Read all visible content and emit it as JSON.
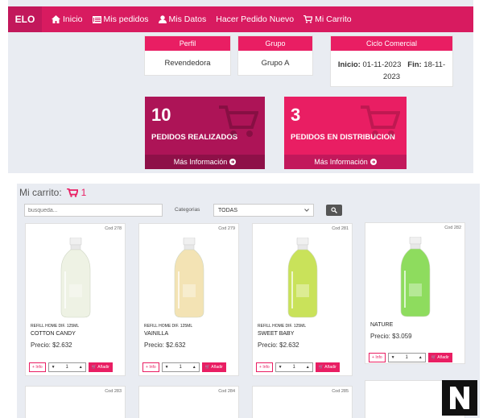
{
  "colors": {
    "primary": "#e91e63",
    "navbar": "#d81b60",
    "brand_bg": "#c2185b",
    "stat_dark": "#ad1457"
  },
  "nav": {
    "brand": "ELO",
    "items": [
      {
        "icon": "home-icon",
        "label": "Inicio"
      },
      {
        "icon": "list-icon",
        "label": "Mis pedidos"
      },
      {
        "icon": "user-icon",
        "label": "Mis Datos"
      },
      {
        "icon": "",
        "label": "Hacer Pedido Nuevo"
      },
      {
        "icon": "cart-icon",
        "label": "Mi Carrito"
      }
    ]
  },
  "profile": {
    "perfil": {
      "header": "Perfil",
      "value": "Revendedora"
    },
    "grupo": {
      "header": "Grupo",
      "value": "Grupo A"
    },
    "ciclo": {
      "header": "Ciclo Comercial",
      "start_label": "Inicio:",
      "start": "01-11-2023",
      "end_label": "Fin:",
      "end_day": "18-11-",
      "end_year": "2023"
    }
  },
  "stats": [
    {
      "number": "10",
      "label": "PEDIDOS REALIZADOS",
      "link": "Más Información"
    },
    {
      "number": "3",
      "label": "PEDIDOS EN DISTRIBUCION",
      "link": "Más Información"
    }
  ],
  "cart": {
    "title": "Mi carrito:",
    "count": "1",
    "search_placeholder": "busqueda...",
    "categories_label": "Categorias",
    "category_selected": "TODAS"
  },
  "products": [
    {
      "code": "Cod 278",
      "kind": "REFILL HOME DIF. 125ML",
      "name": "COTTON CANDY",
      "price": "Precio: $2.632",
      "liquid": "#eef2e4"
    },
    {
      "code": "Cod 279",
      "kind": "REFILL HOME DIF. 125ML",
      "name": "VAINILLA",
      "price": "Precio: $2.632",
      "liquid": "#f3e3b4"
    },
    {
      "code": "Cod 281",
      "kind": "REFILL HOME DIF. 125ML",
      "name": "SWEET BABY",
      "price": "Precio: $2.632",
      "liquid": "#c9e25a"
    },
    {
      "code": "Cod 282",
      "kind": "",
      "name": "NATURE",
      "price": "Precio: $3.059",
      "liquid": "#8edc5e"
    }
  ],
  "products_next_row": [
    {
      "code": "Cod 283"
    },
    {
      "code": "Cod 284"
    },
    {
      "code": "Cod 285"
    },
    {
      "code": ""
    }
  ],
  "controls": {
    "info_label": "Info",
    "qty": "1",
    "add_label": "Añadir"
  }
}
